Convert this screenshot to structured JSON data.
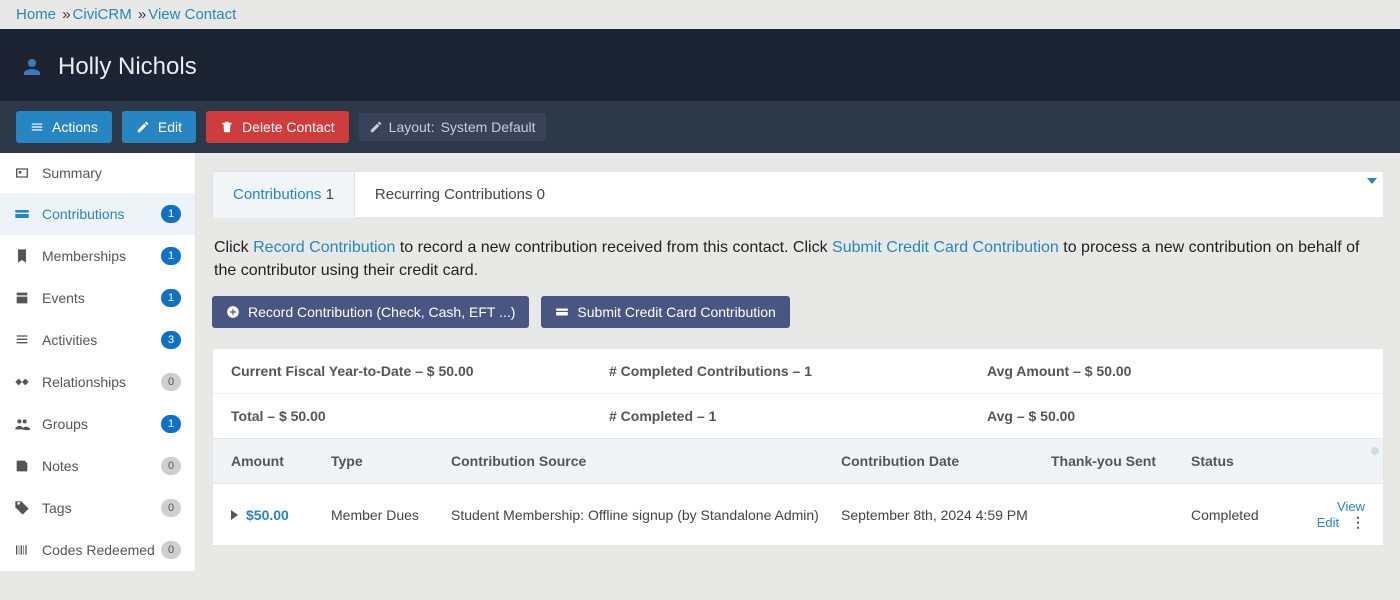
{
  "breadcrumb": {
    "home": "Home",
    "crm": "CiviCRM",
    "view": "View Contact",
    "sep": "»"
  },
  "contact_name": "Holly Nichols",
  "toolbar": {
    "actions": "Actions",
    "edit": "Edit",
    "delete": "Delete Contact",
    "layout_prefix": "Layout:",
    "layout_value": "System Default"
  },
  "sidebar": {
    "items": [
      {
        "label": "Summary",
        "badge": "",
        "active": false
      },
      {
        "label": "Contributions",
        "badge": "1",
        "active": true
      },
      {
        "label": "Memberships",
        "badge": "1",
        "active": false
      },
      {
        "label": "Events",
        "badge": "1",
        "active": false
      },
      {
        "label": "Activities",
        "badge": "3",
        "active": false
      },
      {
        "label": "Relationships",
        "badge": "0",
        "active": false,
        "gray": true
      },
      {
        "label": "Groups",
        "badge": "1",
        "active": false
      },
      {
        "label": "Notes",
        "badge": "0",
        "active": false,
        "gray": true
      },
      {
        "label": "Tags",
        "badge": "0",
        "active": false,
        "gray": true
      },
      {
        "label": "Codes Redeemed",
        "badge": "0",
        "active": false,
        "gray": true
      }
    ]
  },
  "tabs": {
    "contrib_label": "Contributions",
    "contrib_count": "1",
    "recur_label": "Recurring Contributions",
    "recur_count": "0"
  },
  "help": {
    "prefix": "Click ",
    "record_link": "Record Contribution",
    "mid": " to record a new contribution received from this contact. Click ",
    "submit_link": "Submit Credit Card Contribution",
    "suffix": " to process a new contribution on behalf of the contributor using their credit card."
  },
  "buttons": {
    "record": "Record Contribution (Check, Cash, EFT ...)",
    "cc": "Submit Credit Card Contribution"
  },
  "summary": {
    "ytd": "Current Fiscal Year-to-Date – $ 50.00",
    "completed_count": "# Completed Contributions – 1",
    "avg_amount": "Avg Amount – $ 50.00",
    "total": "Total – $ 50.00",
    "completed": "# Completed – 1",
    "avg": "Avg – $ 50.00"
  },
  "table": {
    "head": {
      "amount": "Amount",
      "type": "Type",
      "source": "Contribution Source",
      "date": "Contribution Date",
      "thank": "Thank-you Sent",
      "status": "Status"
    },
    "row": {
      "amount": "$50.00",
      "type": "Member Dues",
      "source": "Student Membership: Offline signup (by Standalone Admin)",
      "date": "September 8th, 2024 4:59 PM",
      "thank": "",
      "status": "Completed",
      "view": "View",
      "edit": "Edit"
    }
  }
}
